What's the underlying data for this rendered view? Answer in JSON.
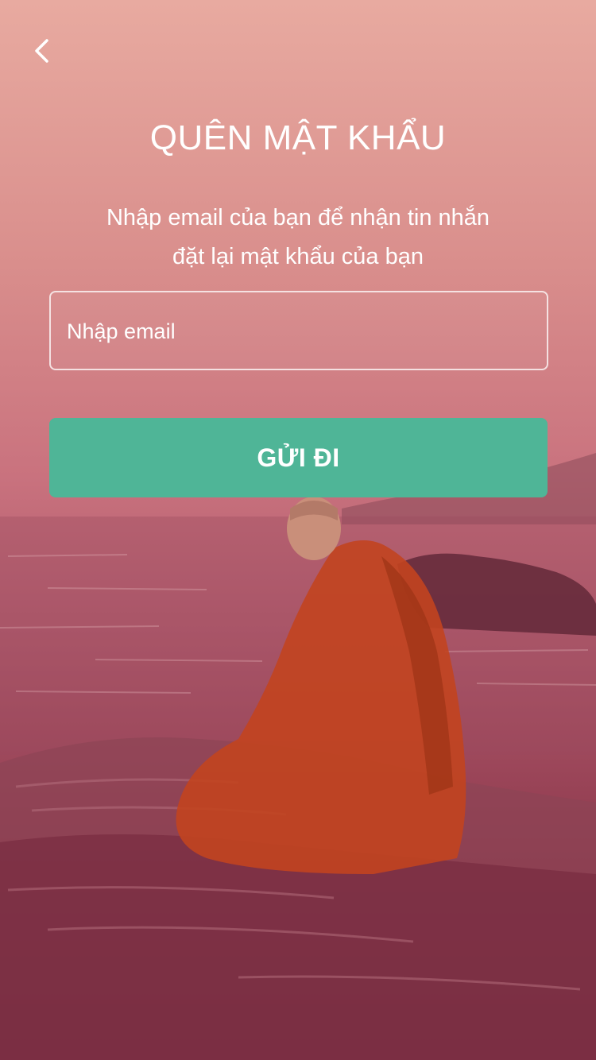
{
  "header": {
    "back_icon": "chevron-left-icon",
    "title": "QUÊN MẬT KHẨU"
  },
  "description": {
    "line1": "Nhập email của bạn để nhận tin nhắn",
    "line2": "đặt lại mật khẩu của bạn"
  },
  "form": {
    "email_value": "",
    "email_placeholder": "Nhập email",
    "submit_label": "GỬI ĐI"
  },
  "colors": {
    "overlay_top": "#e8aaa0",
    "overlay_bottom": "#6f1f34",
    "button": "#4fb597",
    "text": "#ffffff"
  }
}
